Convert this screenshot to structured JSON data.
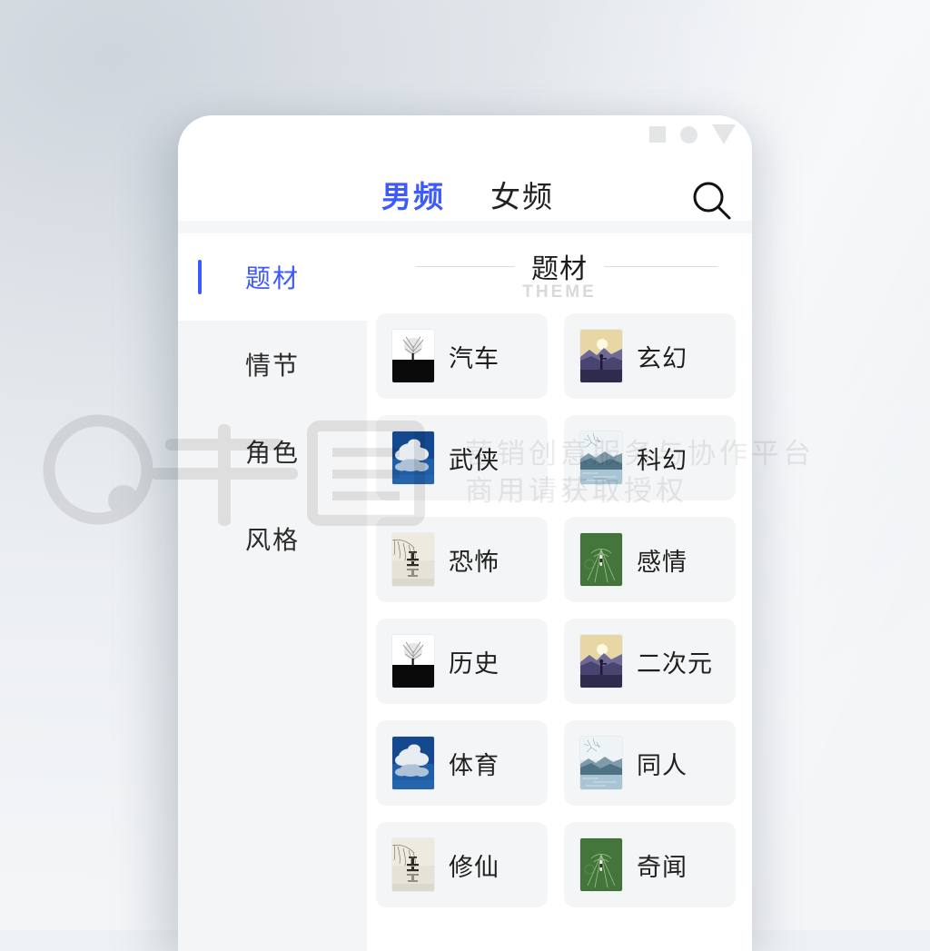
{
  "app": {
    "status_icons": [
      "square-indicator",
      "circle-indicator",
      "triangle-indicator"
    ],
    "accent_color": "#3d5afe",
    "panel_bg": "#f4f5f6"
  },
  "tabs": [
    {
      "label": "男频",
      "active": true
    },
    {
      "label": "女频",
      "active": false
    }
  ],
  "search": {
    "icon": "search-icon"
  },
  "sidebar": {
    "items": [
      {
        "label": "题材",
        "active": true
      },
      {
        "label": "情节",
        "active": false
      },
      {
        "label": "角色",
        "active": false
      },
      {
        "label": "风格",
        "active": false
      }
    ]
  },
  "panel": {
    "title": "题材",
    "subtitle": "THEME"
  },
  "categories": [
    {
      "label": "汽车",
      "thumb": "tree-black-field"
    },
    {
      "label": "玄幻",
      "thumb": "sunset-silhouette"
    },
    {
      "label": "武侠",
      "thumb": "blue-sky-clouds"
    },
    {
      "label": "科幻",
      "thumb": "misty-mountain-lake"
    },
    {
      "label": "恐怖",
      "thumb": "ink-wash-willow"
    },
    {
      "label": "感情",
      "thumb": "green-field-aerial"
    },
    {
      "label": "历史",
      "thumb": "tree-black-field"
    },
    {
      "label": "二次元",
      "thumb": "sunset-silhouette"
    },
    {
      "label": "体育",
      "thumb": "blue-sky-clouds"
    },
    {
      "label": "同人",
      "thumb": "misty-mountain-lake"
    },
    {
      "label": "修仙",
      "thumb": "ink-wash-willow"
    },
    {
      "label": "奇闻",
      "thumb": "green-field-aerial"
    }
  ],
  "watermark": {
    "line1": "营销创意服务与协作平台",
    "line2": "商用请获取授权",
    "logo": "qiantu-logo"
  }
}
